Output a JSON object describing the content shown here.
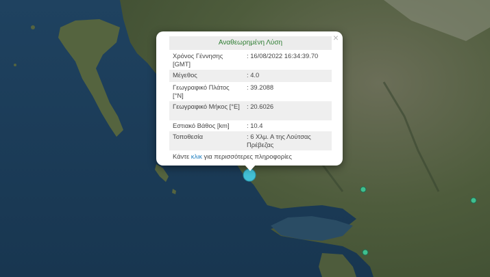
{
  "popup": {
    "title": "Αναθεωρημένη Λύση",
    "close_symbol": "×",
    "rows": [
      {
        "label": "Χρόνος Γέννησης [GMT]",
        "value": ": 16/08/2022 16:34:39.70"
      },
      {
        "label": "Μέγεθος",
        "value": ": 4.0"
      },
      {
        "label": "Γεωγραφικό Πλάτος [°N]",
        "value": ": 39.2088"
      },
      {
        "label": "Γεωγραφικό Μήκος [°E]",
        "value": ": 20.6026"
      },
      {
        "label": "Εστιακό Βάθος [km]",
        "value": ": 10.4"
      },
      {
        "label": "Τοποθεσία",
        "value": ": 6 Χλμ. Α της Λούτσας Πρέβεζας"
      }
    ],
    "footer_prefix": "Κάντε",
    "footer_link": "κλικ",
    "footer_suffix": "για περισσότερες πληροφορίες"
  },
  "colors": {
    "sea": "#1b3a55",
    "land": "#4a5a3a",
    "marker_selected": "#43c0d6",
    "marker_green": "#3fbf8f",
    "title_text": "#2e7d32",
    "link": "#1f7fc0"
  },
  "icons": {
    "close": "close-icon",
    "marker": "earthquake-marker-icon"
  }
}
